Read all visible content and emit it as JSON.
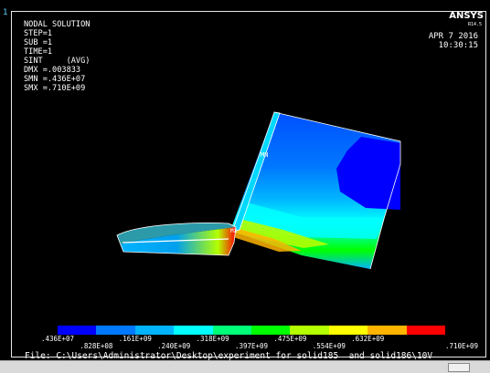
{
  "window_number": "1",
  "brand": "ANSYS",
  "version": "R14.5",
  "date": "APR  7 2016",
  "time": "10:30:15",
  "info_lines": [
    "NODAL SOLUTION",
    "",
    "STEP=1",
    "SUB =1",
    "TIME=1",
    "SINT     (AVG)",
    "DMX =.003833",
    "SMN =.436E+07",
    "SMX =.710E+09"
  ],
  "markers": {
    "mn": "MN",
    "mx": "MX"
  },
  "legend": {
    "colors": [
      "#0000ff",
      "#0078ff",
      "#00b4ff",
      "#00ffff",
      "#00ff78",
      "#00ff00",
      "#b4ff00",
      "#ffff00",
      "#ffb400",
      "#ff0000"
    ],
    "labels_top": [
      ".436E+07",
      ".161E+09",
      ".318E+09",
      ".475E+09",
      ".632E+09"
    ],
    "labels_bottom": [
      ".828E+08",
      ".240E+09",
      ".397E+09",
      ".554E+09",
      ".710E+09"
    ]
  },
  "file_line": "File: C:\\Users\\Administrator\\Desktop\\experiment for solid185  and solid186\\10V"
}
